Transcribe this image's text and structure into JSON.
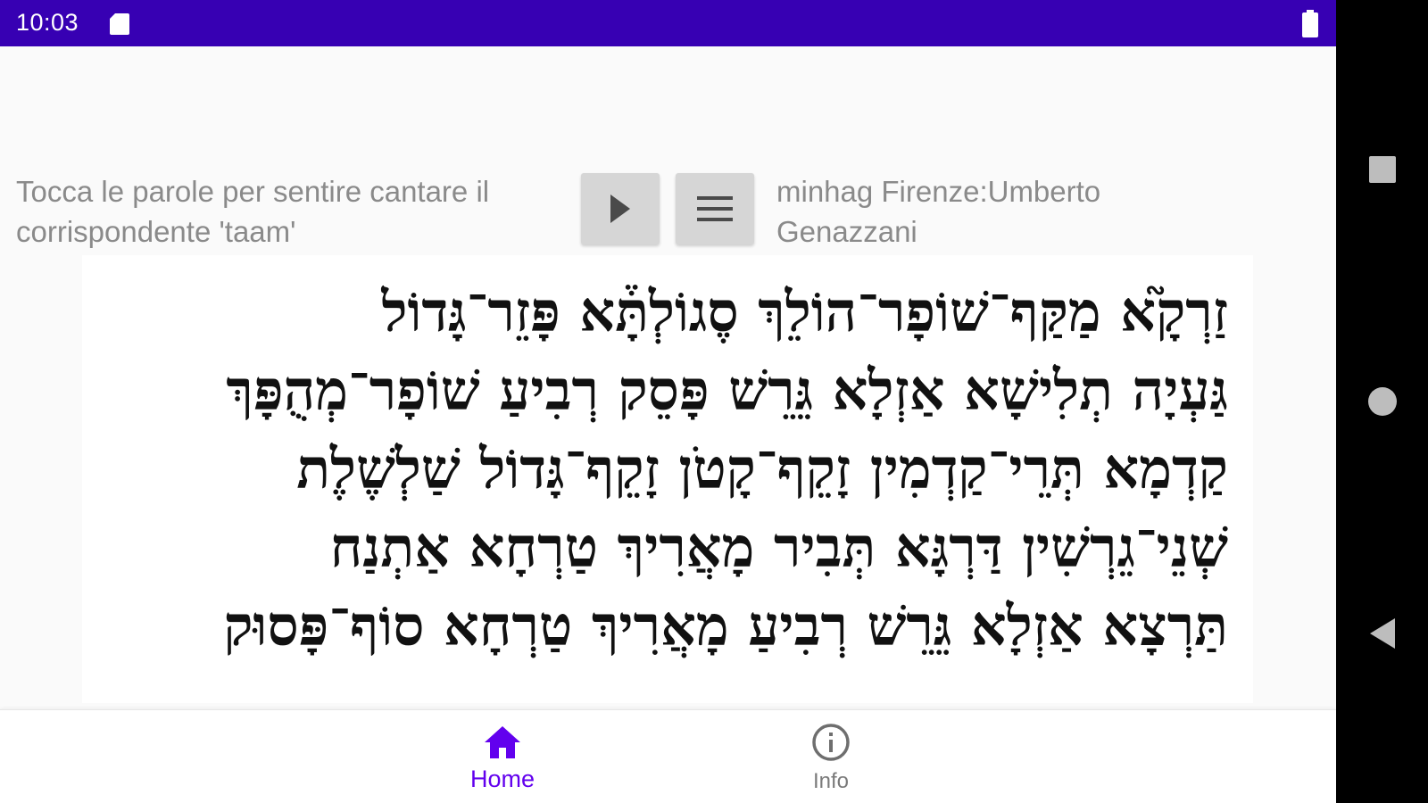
{
  "status_bar": {
    "time": "10:03",
    "background_color": "#3700b3",
    "icons": [
      "sd-card-icon",
      "battery-icon"
    ]
  },
  "header": {
    "instruction": "Tocca le parole per sentire cantare il corrispondente 'taam'",
    "credit": "minhag Firenze:Umberto Genazzani",
    "play_icon": "play-icon",
    "menu_icon": "menu-icon"
  },
  "hebrew_text": {
    "lines": [
      "זַרְקָ֮א מַקַּף־שׁוֹפָר־הוֹלֵךְ סֶגוֹלְתָּ֒א פָּזֵר־גָּדוֹל",
      "גַּעְיָה תְלִישָׁא אַזְלָא גֵּרֵשׁ פָּסֵק רְבִיעַ שׁוֹפָר־מְהֻפָּךְ",
      "קַדְמָא תְּרֵי־קַדְמִין זָקֵף־קָטֹן זָקֵף־גָּדוֹל שַׁלְשֶׁלֶת",
      "שְׁנֵי־גֵרְשִׁין דַּרְגָּא תְּבִיר מָאֲרִיךְ טַרְחָא אַתְנַח",
      "תַּרְצָא אַזְלָא גֵּרֵשׁ רְבִיעַ מָאֲרִיךְ טַרְחָא סוֹף־פָּסוּק"
    ]
  },
  "bottom_nav": {
    "items": [
      {
        "label": "Home",
        "icon": "home-icon",
        "active": true,
        "color": "#6200ee"
      },
      {
        "label": "Info",
        "icon": "info-icon",
        "active": false,
        "color": "#7a7a7a"
      }
    ]
  },
  "system_nav": {
    "icons": [
      "recent-apps-icon",
      "home-circle-icon",
      "back-icon"
    ]
  }
}
